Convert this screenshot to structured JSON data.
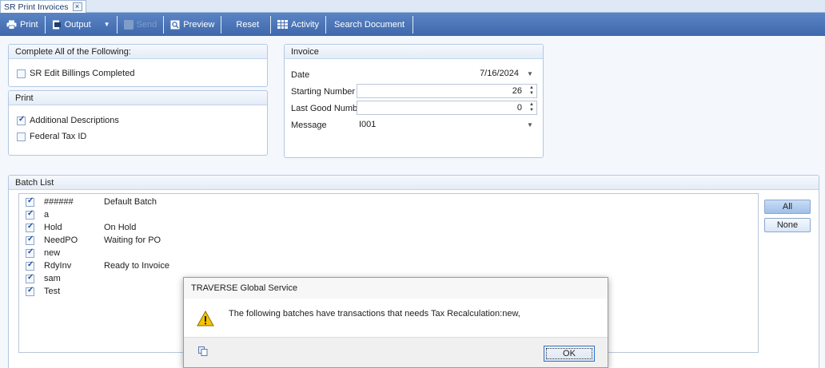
{
  "tab": {
    "title": "SR Print Invoices",
    "close_glyph": "×"
  },
  "toolbar": {
    "print": "Print",
    "output": "Output",
    "caret": "▼",
    "send": "Send",
    "preview": "Preview",
    "reset": "Reset",
    "activity": "Activity",
    "search_document": "Search Document"
  },
  "complete_panel": {
    "title": "Complete All of the Following:",
    "items": [
      {
        "label": "SR Edit Billings Completed",
        "checked": false
      }
    ]
  },
  "print_panel": {
    "title": "Print",
    "items": [
      {
        "label": "Additional Descriptions",
        "checked": true
      },
      {
        "label": "Federal Tax ID",
        "checked": false
      }
    ]
  },
  "invoice_panel": {
    "title": "Invoice",
    "date_label": "Date",
    "date_value": "7/16/2024",
    "starting_number_label": "Starting Number",
    "starting_number_value": "26",
    "last_good_number_label": "Last Good Number",
    "last_good_number_value": "0",
    "message_label": "Message",
    "message_value": "I001"
  },
  "batch_panel": {
    "title": "Batch List",
    "rows": [
      {
        "id": "######",
        "description": "Default Batch",
        "checked": true
      },
      {
        "id": "a",
        "description": "",
        "checked": true
      },
      {
        "id": "Hold",
        "description": "On Hold",
        "checked": true
      },
      {
        "id": "NeedPO",
        "description": "Waiting for PO",
        "checked": true
      },
      {
        "id": "new",
        "description": "",
        "checked": true
      },
      {
        "id": "RdyInv",
        "description": "Ready to Invoice",
        "checked": true
      },
      {
        "id": "sam",
        "description": "",
        "checked": true
      },
      {
        "id": "Test",
        "description": "",
        "checked": true
      }
    ],
    "all_button": "All",
    "none_button": "None"
  },
  "dialog": {
    "title": "TRAVERSE Global Service",
    "message": "The following batches have transactions that needs Tax Recalculation:new,",
    "ok_button": "OK"
  },
  "colors": {
    "toolbar": "#4a74b8",
    "panel_border": "#b4c8e4",
    "check": "#1b4f9c"
  },
  "icons": {
    "print": "printer-icon",
    "output": "output-icon",
    "send": "send-icon",
    "preview": "preview-icon",
    "activity": "activity-grid-icon",
    "warning": "warning-icon",
    "copy": "copy-icon"
  }
}
